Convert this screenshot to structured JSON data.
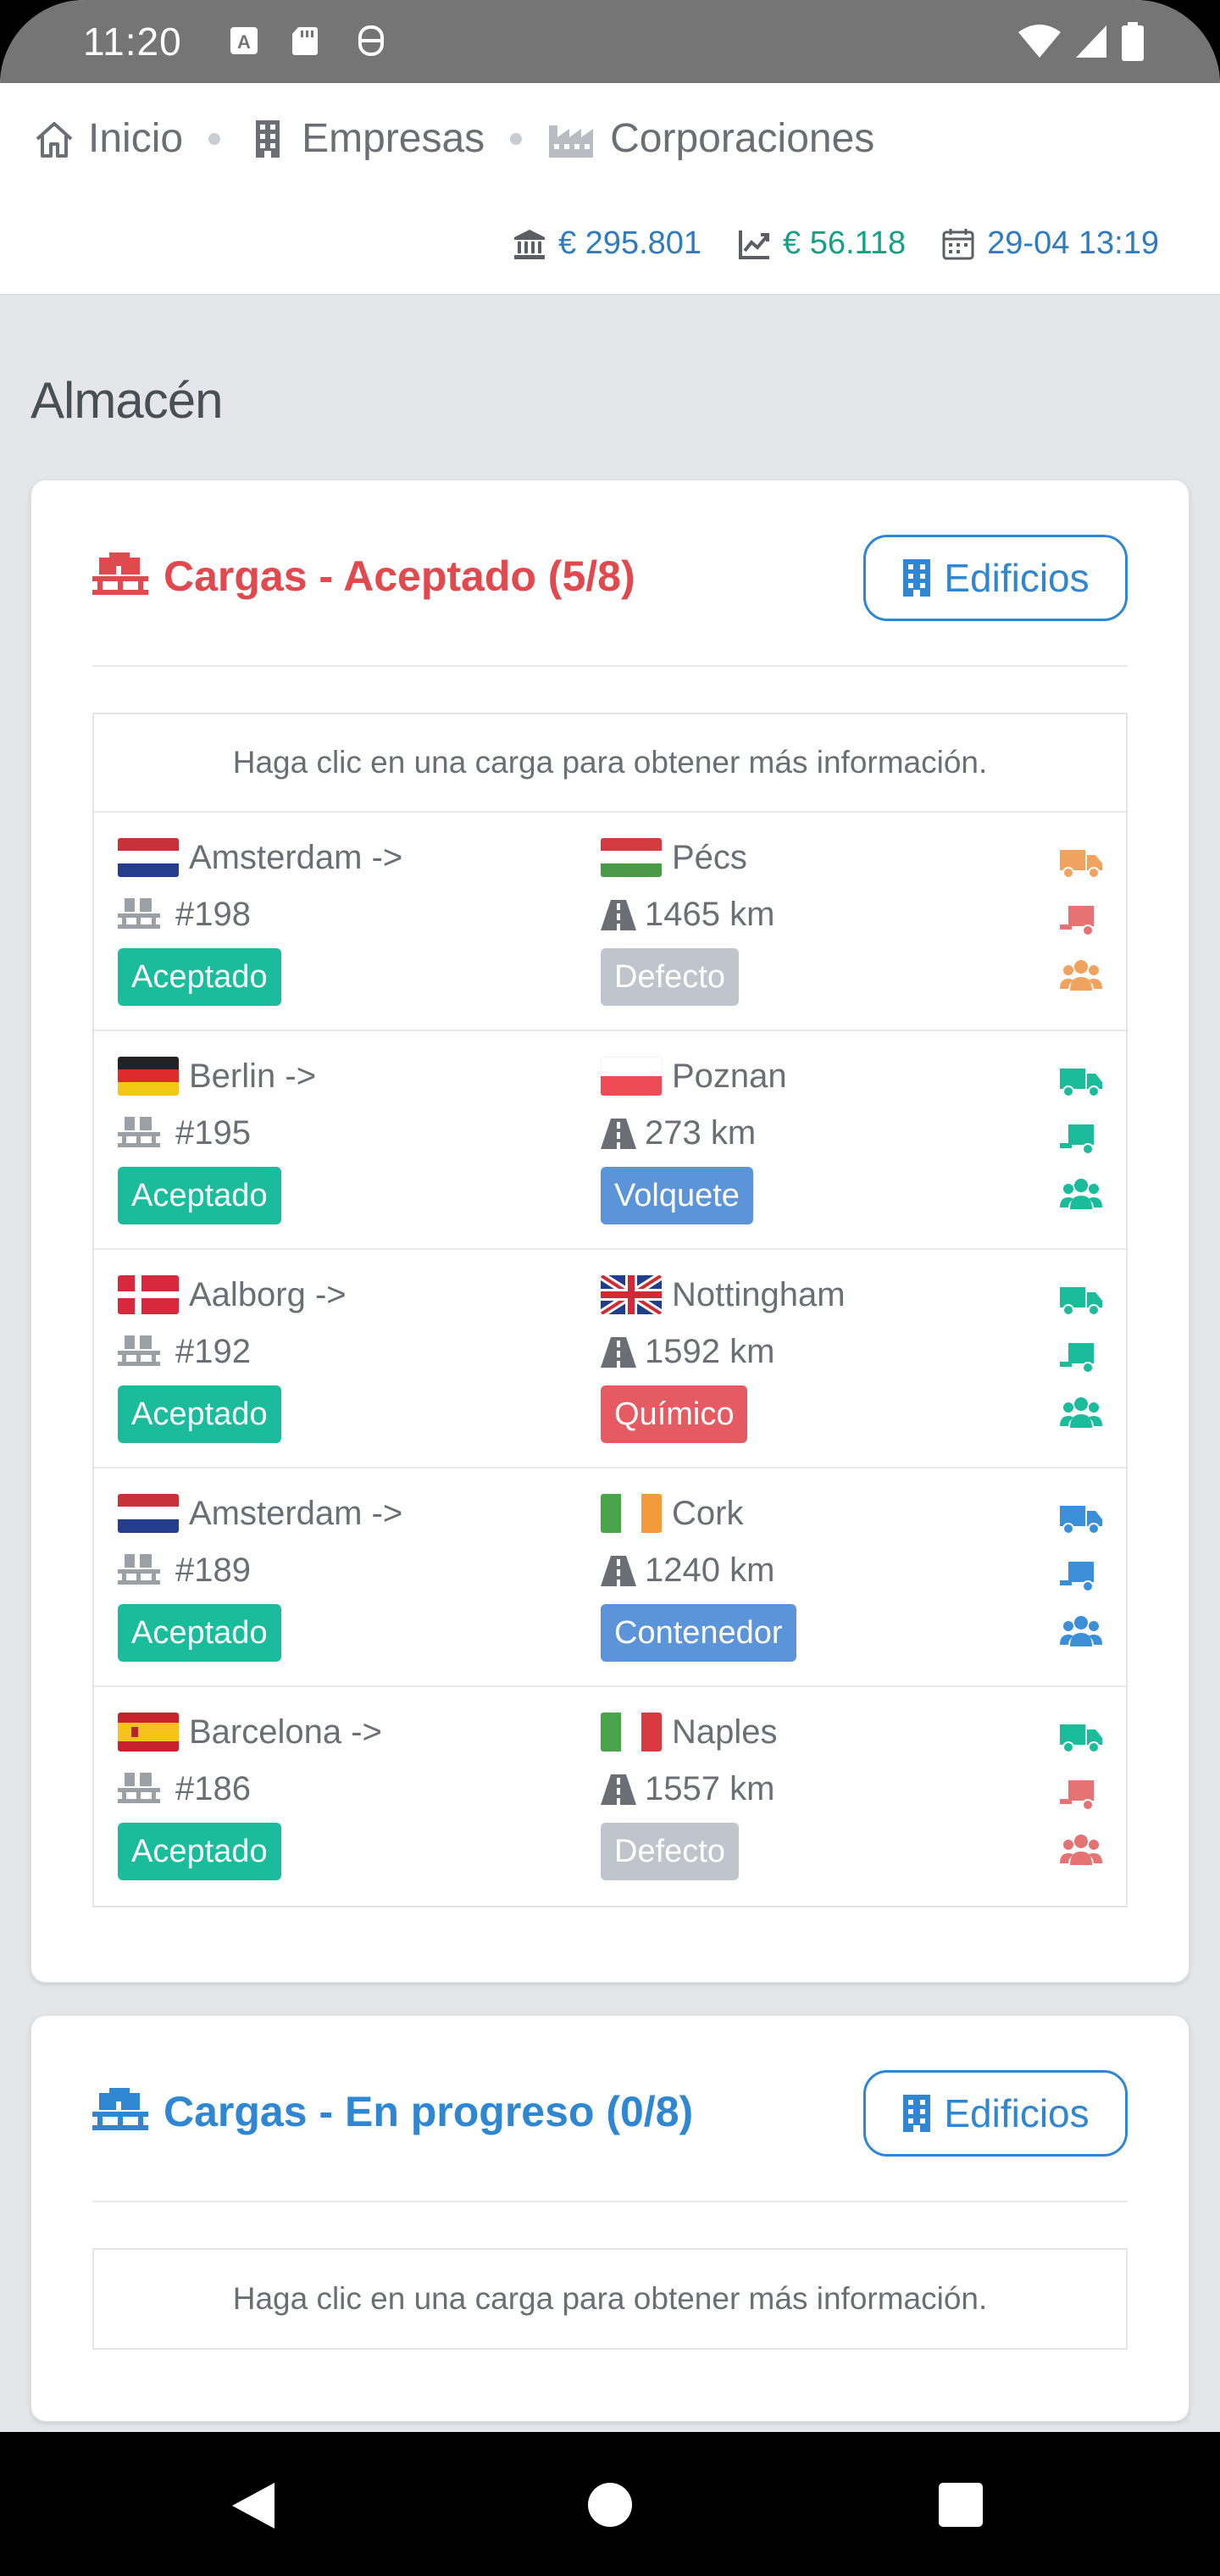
{
  "status_bar": {
    "time": "11:20"
  },
  "breadcrumb": [
    {
      "label": "Inicio",
      "icon": "home-icon"
    },
    {
      "label": "Empresas",
      "icon": "building-icon"
    },
    {
      "label": "Corporaciones",
      "icon": "industry-icon"
    }
  ],
  "stats": {
    "bank": "€ 295.801",
    "profit": "€ 56.118",
    "date": "29-04 13:19"
  },
  "section_title": "Almacén",
  "cards": [
    {
      "title": "Cargas - Aceptado (5/8)",
      "title_color": "#e04a4f",
      "button": "Edificios",
      "hint": "Haga clic en una carga para obtener más información."
    },
    {
      "title": "Cargas - En progreso (0/8)",
      "title_color": "#2f86d1",
      "button": "Edificios",
      "hint": "Haga clic en una carga para obtener más información."
    }
  ],
  "loads": [
    {
      "from": "Amsterdam ->",
      "from_flag": "nl",
      "id": "#198",
      "status": "Aceptado",
      "to": "Pécs",
      "to_flag": "hu",
      "distance": "1465 km",
      "type": "Defecto",
      "type_color": "#bfc5cc",
      "icon_colors": [
        "#f0a35e",
        "#e57373",
        "#f0a35e"
      ]
    },
    {
      "from": "Berlin ->",
      "from_flag": "de",
      "id": "#195",
      "status": "Aceptado",
      "to": "Poznan",
      "to_flag": "pl",
      "distance": "273 km",
      "type": "Volquete",
      "type_color": "#5b94d8",
      "icon_colors": [
        "#1abc9c",
        "#1abc9c",
        "#1abc9c"
      ]
    },
    {
      "from": "Aalborg ->",
      "from_flag": "dk",
      "id": "#192",
      "status": "Aceptado",
      "to": "Nottingham",
      "to_flag": "gb",
      "distance": "1592 km",
      "type": "Químico",
      "type_color": "#e65a62",
      "icon_colors": [
        "#1abc9c",
        "#1abc9c",
        "#1abc9c"
      ]
    },
    {
      "from": "Amsterdam ->",
      "from_flag": "nl",
      "id": "#189",
      "status": "Aceptado",
      "to": "Cork",
      "to_flag": "ie",
      "distance": "1240 km",
      "type": "Contenedor",
      "type_color": "#5b94d8",
      "icon_colors": [
        "#3b8fd8",
        "#3b8fd8",
        "#3b8fd8"
      ]
    },
    {
      "from": "Barcelona ->",
      "from_flag": "es",
      "id": "#186",
      "status": "Aceptado",
      "to": "Naples",
      "to_flag": "it",
      "distance": "1557 km",
      "type": "Defecto",
      "type_color": "#bfc5cc",
      "icon_colors": [
        "#1abc9c",
        "#e57373",
        "#e57373"
      ]
    }
  ],
  "colors": {
    "accepted_green": "#1abc9c",
    "link_blue": "#2f86d1",
    "stat_green": "#16a085"
  }
}
